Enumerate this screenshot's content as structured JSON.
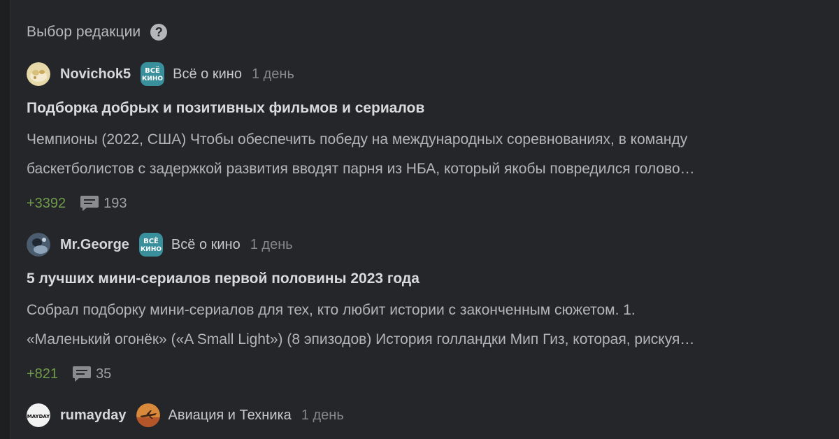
{
  "header": {
    "title": "Выбор редакции",
    "help_symbol": "?"
  },
  "posts": [
    {
      "author": "Novichok5",
      "community": "Всё о кино",
      "time": "1 день",
      "title": "Подборка добрых и позитивных фильмов и сериалов",
      "excerpt_line1": "Чемпионы (2022, США) Чтобы обеспечить победу на международных соревнованиях, в команду",
      "excerpt_line2": "баскетболистов с задержкой развития вводят парня из НБА, который якобы повредился голово…",
      "rating": "+3392",
      "comments": "193",
      "community_icon": "vse-kino-icon",
      "community_icon_text_top": "ВСЁ",
      "community_icon_text_bottom": "КИНО"
    },
    {
      "author": "Mr.George",
      "community": "Всё о кино",
      "time": "1 день",
      "title": "5 лучших мини-сериалов первой половины 2023 года",
      "excerpt_line1": "Собрал подборку мини-сериалов для тех, кто любит истории с законченным сюжетом. 1.",
      "excerpt_line2": "«Маленький огонёк» («A Small Light») (8 эпизодов) История голландки Мип Гиз, которая, рискуя…",
      "rating": "+821",
      "comments": "35",
      "community_icon": "vse-kino-icon",
      "community_icon_text_top": "ВСЁ",
      "community_icon_text_bottom": "КИНО"
    },
    {
      "author": "rumayday",
      "community": "Авиация и Техника",
      "time": "1 день",
      "avatar_text": "MAYDAY",
      "community_icon": "aviation-icon"
    }
  ],
  "colors": {
    "background": "#1e1f21",
    "panel": "#252629",
    "rating_positive": "#6f9b4b",
    "community_teal": "#3a8f9c"
  }
}
